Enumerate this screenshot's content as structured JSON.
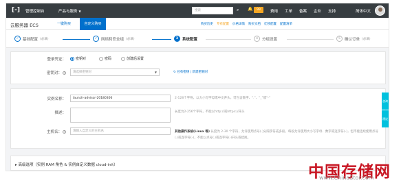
{
  "topnav": {
    "logo": "[-]",
    "console": "管理控制台",
    "products": "产品与服务",
    "search_placeholder": "搜索",
    "badge": "99",
    "links": [
      "费用",
      "工单",
      "备案",
      "企业",
      "支持",
      "简体中文"
    ]
  },
  "subheader": {
    "title": "云服务器 ECS",
    "tab_quick": "一键购买",
    "tab_custom": "自定义购买",
    "links": [
      "购买历史",
      "专有配置",
      "价格详情",
      "购买文档",
      "迁移配置",
      "配置清单"
    ]
  },
  "steps": [
    {
      "num": "✓",
      "label": "基础配置",
      "opt": "(必填)"
    },
    {
      "num": "✓",
      "label": "网络和安全组",
      "opt": "(必填)"
    },
    {
      "num": "3",
      "label": "系统配置",
      "opt": ""
    },
    {
      "num": "4",
      "label": "分组设置",
      "opt": ""
    },
    {
      "num": "5",
      "label": "确认订单",
      "opt": "(必填)"
    }
  ],
  "login": {
    "label": "登录凭证：",
    "options": [
      "密钥对",
      "密码",
      "创建后设置"
    ],
    "keypair_label": "密钥对：",
    "keypair_placeholder": "请选择密钥对",
    "links": "已有密钥 | 新建密钥对"
  },
  "instance": {
    "name_label": "实例名称：",
    "name_value": "launch-advisor-20180306",
    "name_hint": "2-128个字符，以大小写字母或中文开头，可包含数字、\".\"、\"_\"或\"-\"",
    "desc_label": "描述：",
    "desc_hint": "长度为2-256个字符，不能以http://或https://开头",
    "host_label": "主机名：",
    "host_placeholder": "请输入自定义的主机名",
    "host_hint_title": "其他操作系统(Linux 等)",
    "host_hint": "长度为 2-30 个字符，允许使用点号(.)分隔字符成多段，每段允许使用大小写字母、数字或连字符(-)，但不能连续使用点号(.)或连字符(-)，不能以点号(.)或连字符(-)开头或结尾。"
  },
  "advanced": "高级选项（实例 RAM 角色 & 实例自定义数据 cloud-init）",
  "side_buttons": [
    "咨询",
    "建议"
  ],
  "watermark": {
    "cn": "中国存储网",
    "url": "www.ChinaStor.com"
  }
}
